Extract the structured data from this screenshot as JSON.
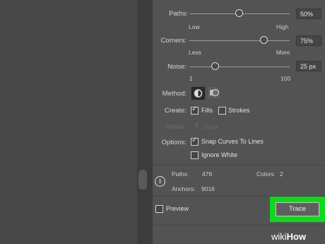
{
  "sliders": [
    {
      "label": "Paths:",
      "value": "50%",
      "level": 0.5,
      "min_label": "Low",
      "max_label": "High"
    },
    {
      "label": "Corners:",
      "value": "75%",
      "level": 0.75,
      "min_label": "Less",
      "max_label": "More"
    },
    {
      "label": "Noise:",
      "value": "25 px",
      "level": 0.25,
      "min_label": "1",
      "max_label": "100"
    }
  ],
  "method": {
    "label": "Method:",
    "selected": "abutting"
  },
  "create": {
    "label": "Create:",
    "fills_label": "Fills",
    "fills_checked": true,
    "strokes_label": "Strokes",
    "strokes_checked": false
  },
  "stroke": {
    "label": "Stroke:",
    "value": "10 px"
  },
  "options": {
    "label": "Options:",
    "snap_label": "Snap Curves To Lines",
    "snap_checked": true,
    "ignore_white_label": "Ignore White",
    "ignore_white_checked": false
  },
  "info": {
    "paths_label": "Paths:",
    "paths_value": "476",
    "colors_label": "Colors:",
    "colors_value": "2",
    "anchors_label": "Anchors:",
    "anchors_value": "9016"
  },
  "footer": {
    "preview_label": "Preview",
    "preview_checked": false,
    "trace_label": "Trace"
  },
  "watermark": {
    "part1": "wiki",
    "part2": "How"
  },
  "colors": {
    "highlight": "#12d71e",
    "panel": "#535353"
  }
}
